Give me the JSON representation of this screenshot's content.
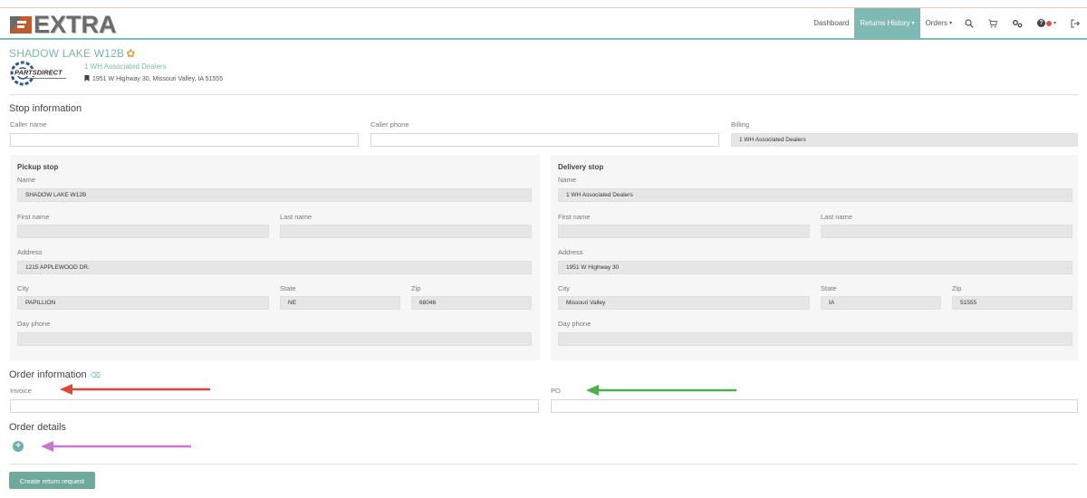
{
  "app": {
    "logo_text": "EXTRA"
  },
  "nav": {
    "dashboard": "Dashboard",
    "returns_history": "Returns History",
    "orders": "Orders",
    "caret": "▾"
  },
  "store": {
    "title": "SHADOW LAKE W12B",
    "dealer_name": "1 WH Associated Dealers",
    "dealer_address": "1951 W Highway 30, Missouri Valley, IA 51555",
    "brand_logo_text": "PARTSDIRECT"
  },
  "stop_info": {
    "title": "Stop information",
    "caller_name_label": "Caller name",
    "caller_name_value": "",
    "caller_phone_label": "Caller phone",
    "caller_phone_value": "",
    "billing_label": "Billing",
    "billing_value": "1 WH Associated Dealers"
  },
  "pickup": {
    "title": "Pickup stop",
    "name_label": "Name",
    "name_value": "SHADOW LAKE W12B",
    "first_name_label": "First name",
    "first_name_value": "",
    "last_name_label": "Last name",
    "last_name_value": "",
    "address_label": "Address",
    "address_value": "1215 APPLEWOOD DR.",
    "city_label": "City",
    "city_value": "PAPILLION",
    "state_label": "State",
    "state_value": "NE",
    "zip_label": "Zip",
    "zip_value": "68046",
    "day_phone_label": "Day phone",
    "day_phone_value": ""
  },
  "delivery": {
    "title": "Delivery stop",
    "name_label": "Name",
    "name_value": "1 WH Associated Dealers",
    "first_name_label": "First name",
    "first_name_value": "",
    "last_name_label": "Last name",
    "last_name_value": "",
    "address_label": "Address",
    "address_value": "1951 W Highway 30",
    "city_label": "City",
    "city_value": "Missouri Valley",
    "state_label": "State",
    "state_value": "IA",
    "zip_label": "Zip",
    "zip_value": "51555",
    "day_phone_label": "Day phone",
    "day_phone_value": ""
  },
  "order_info": {
    "title": "Order information",
    "invoice_label": "Invoice",
    "invoice_value": "",
    "po_label": "PO",
    "po_value": ""
  },
  "order_details": {
    "title": "Order details",
    "add_symbol": "+"
  },
  "actions": {
    "create_label": "Create return request"
  },
  "colors": {
    "accent": "#7fb9b4",
    "arrow_red": "#e0463a",
    "arrow_green": "#4caf50",
    "arrow_purple": "#c978c9",
    "submit": "#6fa99e"
  }
}
